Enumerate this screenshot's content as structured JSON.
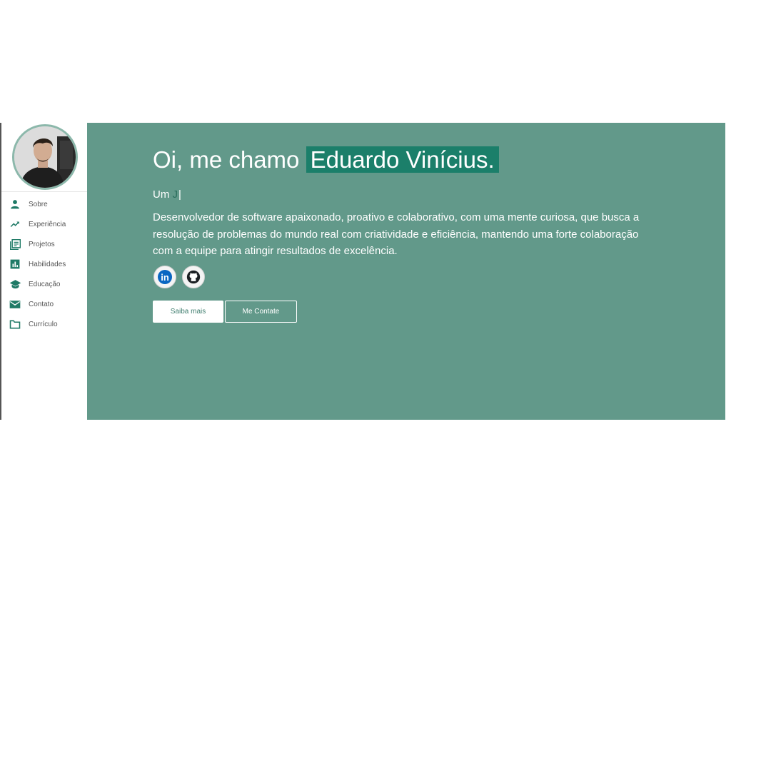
{
  "sidebar": {
    "items": [
      {
        "label": "Sobre",
        "icon": "person-icon"
      },
      {
        "label": "Experiência",
        "icon": "trending-up-icon"
      },
      {
        "label": "Projetos",
        "icon": "article-icon"
      },
      {
        "label": "Habilidades",
        "icon": "bar-chart-icon"
      },
      {
        "label": "Educação",
        "icon": "school-icon"
      },
      {
        "label": "Contato",
        "icon": "mail-icon"
      },
      {
        "label": "Currículo",
        "icon": "folder-icon"
      }
    ]
  },
  "hero": {
    "greeting": "Oi, me chamo ",
    "name": "Eduardo Vinícius.",
    "typing_prefix": "Um ",
    "typing_text": "J",
    "typing_cursor": "|",
    "description": "Desenvolvedor de software apaixonado, proativo e colaborativo, com uma mente curiosa, que busca a resolução de problemas do mundo real com criatividade e eficiência, mantendo uma forte colaboração com a equipe para atingir resultados de excelência."
  },
  "social": {
    "linkedin_text": "in"
  },
  "buttons": {
    "primary": "Saiba mais",
    "secondary": "Me Contate"
  },
  "colors": {
    "main_background": "#62998a",
    "accent": "#1b7f6a",
    "icon": "#1f7a66"
  }
}
